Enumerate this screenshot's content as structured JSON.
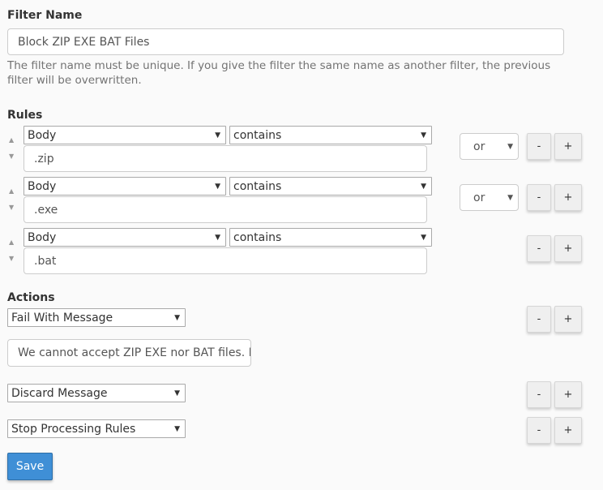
{
  "filter_name": {
    "label": "Filter Name",
    "value": "Block ZIP EXE BAT Files",
    "help": "The filter name must be unique. If you give the filter the same name as another filter, the previous filter will be overwritten."
  },
  "rules": {
    "label": "Rules",
    "items": [
      {
        "field": "Body",
        "operator": "contains",
        "value": ".zip",
        "conjunction": "or"
      },
      {
        "field": "Body",
        "operator": "contains",
        "value": ".exe",
        "conjunction": "or"
      },
      {
        "field": "Body",
        "operator": "contains",
        "value": ".bat",
        "conjunction": null
      }
    ],
    "move_up_icon": "▲",
    "move_down_icon": "▼",
    "remove_label": "-",
    "add_label": "+"
  },
  "actions": {
    "label": "Actions",
    "items": [
      {
        "action": "Fail With Message",
        "message": "We cannot accept ZIP EXE nor BAT files. Please"
      },
      {
        "action": "Discard Message"
      },
      {
        "action": "Stop Processing Rules"
      }
    ],
    "remove_label": "-",
    "add_label": "+"
  },
  "caret_icon": "▼",
  "save_label": "Save"
}
